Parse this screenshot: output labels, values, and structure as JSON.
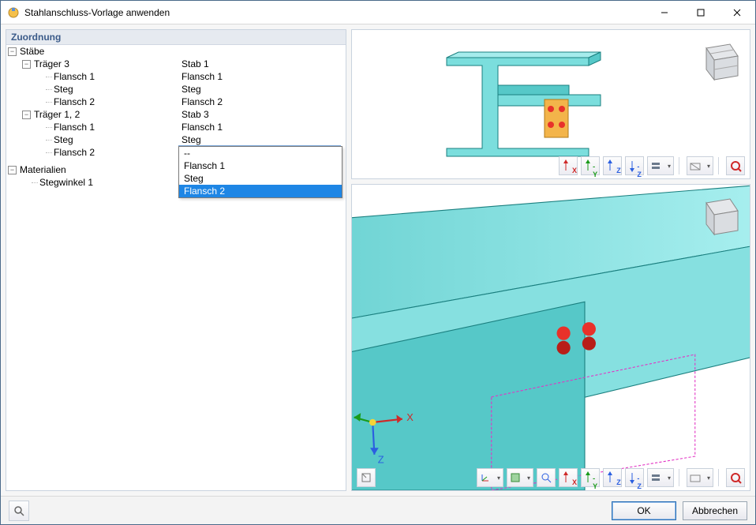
{
  "window": {
    "title": "Stahlanschluss-Vorlage anwenden"
  },
  "section": {
    "zuordnung": "Zuordnung"
  },
  "tree": {
    "stabe": {
      "label": "Stäbe",
      "traeger3": {
        "label": "Träger 3",
        "value": "Stab 1",
        "children": [
          {
            "label": "Flansch 1",
            "value": "Flansch 1"
          },
          {
            "label": "Steg",
            "value": "Steg"
          },
          {
            "label": "Flansch 2",
            "value": "Flansch 2"
          }
        ]
      },
      "traeger12": {
        "label": "Träger 1, 2",
        "value": "Stab 3",
        "children": [
          {
            "label": "Flansch 1",
            "value": "Flansch 1"
          },
          {
            "label": "Steg",
            "value": "Steg"
          },
          {
            "label": "Flansch 2",
            "value": "Flansch 2"
          }
        ]
      }
    },
    "materialien": {
      "label": "Materialien",
      "children": [
        {
          "label": "Stegwinkel 1",
          "value": ""
        }
      ]
    }
  },
  "dropdown": {
    "selected": "Flansch 2",
    "options": [
      "--",
      "Flansch 1",
      "Steg",
      "Flansch 2"
    ]
  },
  "footer": {
    "ok": "OK",
    "cancel": "Abbrechen"
  },
  "colors": {
    "accent": "#1e86e5",
    "beam": "#7bdedd",
    "beam_dark": "#3fb8b8",
    "plate": "#f3b44a",
    "bolt": "#e8312a"
  }
}
